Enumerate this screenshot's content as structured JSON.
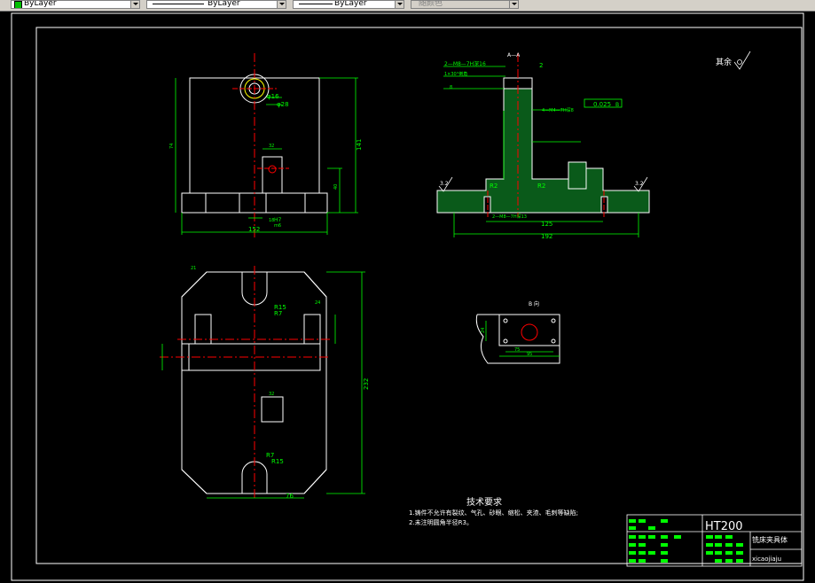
{
  "toolbar": {
    "layer_combo": "ByLayer",
    "linetype_combo": "ByLayer",
    "lineweight_combo": "ByLayer",
    "color_combo": "随颜色"
  },
  "drawing": {
    "section_label": "A—A",
    "view_label": "B 向",
    "roughness_note": "其余",
    "roughness_left": "3.2",
    "roughness_right": "3.2",
    "dims_front": {
      "width_total": "152",
      "height_total": "141",
      "dia1": "φ16",
      "dia2": "φ28",
      "d32": "32",
      "d18": "18",
      "h7": "H7",
      "m6": "m6",
      "d74": "74",
      "d40": "40"
    },
    "dims_section": {
      "thread1": "2—M8—7H深16",
      "thread2": "1×30°倒角",
      "thread3": "4—M4—7H深8",
      "thread4": "2—M8—7H深13",
      "d125": "125",
      "d192": "192",
      "r2a": "R2",
      "r2b": "R2",
      "tol": "0.025",
      "datum": "B",
      "d2": "2",
      "d8": "8"
    },
    "dims_top": {
      "r15a": "R15",
      "r7a": "R7",
      "r7b": "R7",
      "r15b": "R15",
      "d232": "232",
      "d76": "76",
      "d21": "21",
      "d24": "24",
      "d32": "32"
    },
    "dims_b": {
      "d75": "75",
      "d95": "95",
      "d24": "24"
    },
    "notes": {
      "title": "技术要求",
      "line1": "1.铸件不允许有裂纹、气孔、砂眼、缩松、夹渣、毛刺等缺陷;",
      "line2": "2.未注明圆角半径R3。"
    },
    "title_block": {
      "material": "HT200",
      "part_name": "铣床夹具体",
      "drawing_no": "xicaojiaju"
    }
  }
}
